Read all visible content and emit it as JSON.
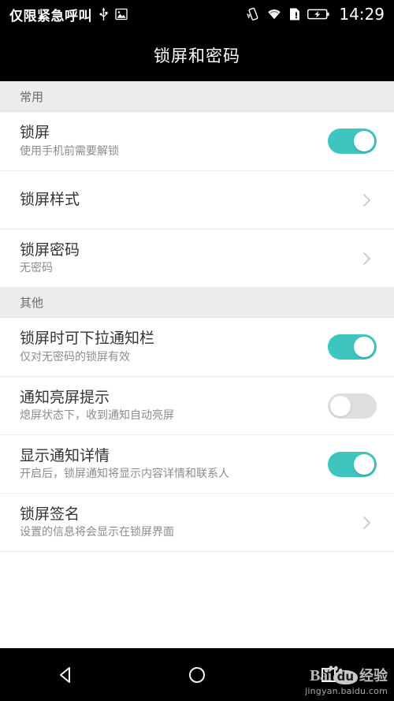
{
  "statusbar": {
    "carrier": "仅限紧急呼叫",
    "clock": "14:29",
    "left_icons": [
      "usb-icon",
      "image-icon"
    ],
    "right_icons": [
      "vibrate-icon",
      "wifi-icon",
      "sim-card-alert-icon",
      "battery-charging-icon"
    ]
  },
  "header": {
    "title": "锁屏和密码"
  },
  "sections": [
    {
      "label": "常用",
      "rows": [
        {
          "title": "锁屏",
          "subtitle": "使用手机前需要解锁",
          "control": "toggle",
          "state": "on"
        },
        {
          "title": "锁屏样式",
          "subtitle": "",
          "control": "chevron",
          "state": ""
        },
        {
          "title": "锁屏密码",
          "subtitle": "无密码",
          "control": "chevron",
          "state": ""
        }
      ]
    },
    {
      "label": "其他",
      "rows": [
        {
          "title": "锁屏时可下拉通知栏",
          "subtitle": "仅对无密码的锁屏有效",
          "control": "toggle",
          "state": "on"
        },
        {
          "title": "通知亮屏提示",
          "subtitle": "熄屏状态下，收到通知自动亮屏",
          "control": "toggle",
          "state": "off"
        },
        {
          "title": "显示通知详情",
          "subtitle": "开启后，锁屏通知将显示内容详情和联系人",
          "control": "toggle",
          "state": "on"
        },
        {
          "title": "锁屏签名",
          "subtitle": "设置的信息将会显示在锁屏界面",
          "control": "chevron",
          "state": ""
        }
      ]
    }
  ],
  "navbar": {
    "back": "back-icon",
    "home": "home-icon",
    "recents": "recents-icon"
  },
  "watermark": {
    "brand": "Bai",
    "brand_mid": "du",
    "brand_cn": "经验",
    "url": "jingyan.baidu.com"
  },
  "colors": {
    "accent": "#3ec5c0",
    "toggle_off": "#dedede",
    "section_bg": "#ececec",
    "title_text": "#333333",
    "sub_text": "#8c8c8c"
  }
}
